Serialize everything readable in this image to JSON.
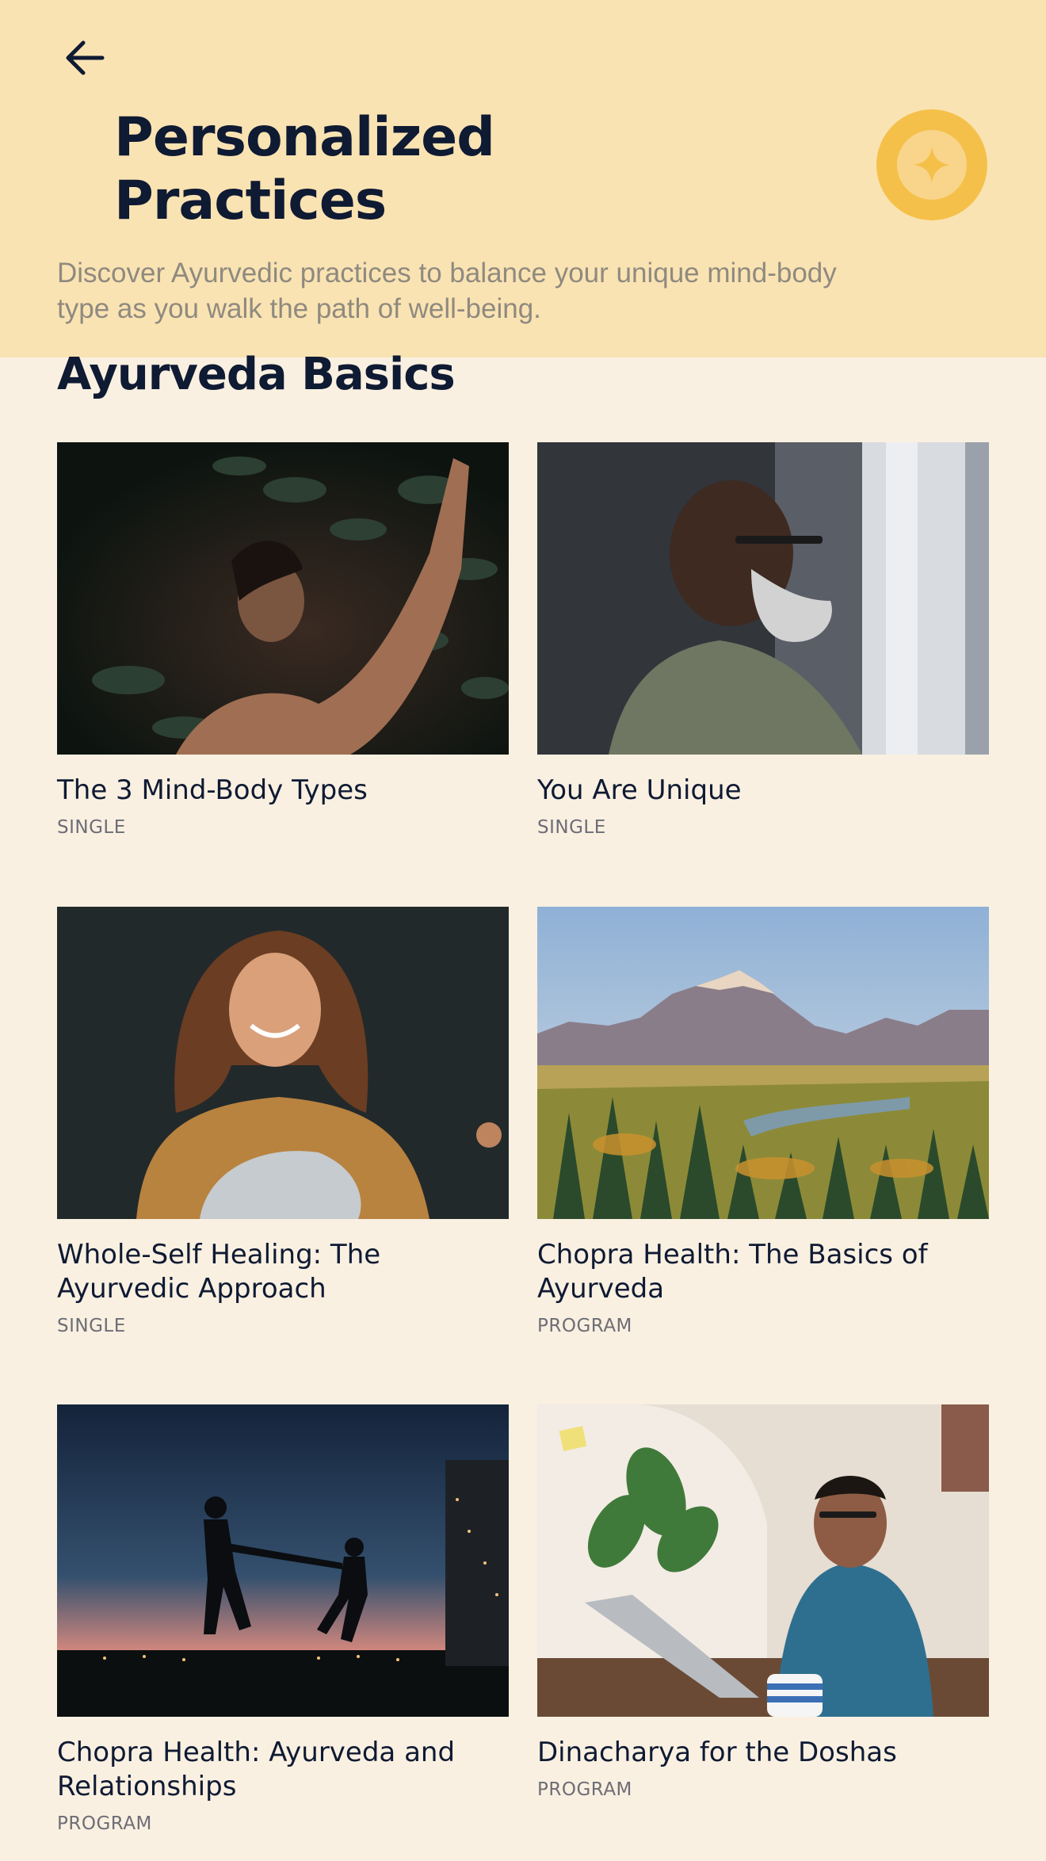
{
  "header": {
    "back_icon": "arrow-left-icon",
    "title_line1": "Personalized",
    "title_line2": "Practices",
    "badge_icon": "sparkle-star-icon",
    "subtitle": "Discover Ayurvedic practices to balance your unique mind-body type as you walk the path of well-being.",
    "colors": {
      "header_bg": "#fae3b2",
      "page_bg": "#f9f0e1",
      "badge": "#f5c04a",
      "text": "#0f1a33"
    }
  },
  "section": {
    "title": "Ayurveda Basics"
  },
  "cards": [
    {
      "title": "The 3 Mind-Body Types",
      "type": "SINGLE",
      "image": "person-reaching-into-foliage"
    },
    {
      "title": "You Are Unique",
      "type": "SINGLE",
      "image": "bearded-man-at-window"
    },
    {
      "title": "Whole-Self Healing: The Ayurvedic Approach",
      "type": "SINGLE",
      "image": "smiling-woman-with-blanket"
    },
    {
      "title": "Chopra Health: The Basics of Ayurveda",
      "type": "PROGRAM",
      "image": "mountain-valley-landscape"
    },
    {
      "title": "Chopra Health: Ayurveda and Relationships",
      "type": "PROGRAM",
      "image": "couple-silhouette-at-dusk"
    },
    {
      "title": "Dinacharya for the Doshas",
      "type": "PROGRAM",
      "image": "man-working-on-laptop"
    }
  ]
}
